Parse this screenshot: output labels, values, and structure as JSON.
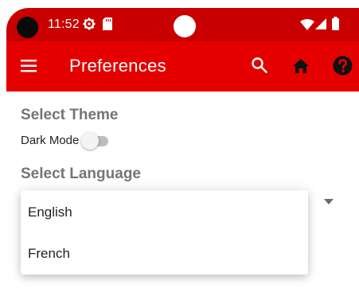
{
  "status_bar": {
    "time": "11:52",
    "icons": [
      "settings-icon",
      "sd-card-icon",
      "wifi-icon",
      "signal-icon",
      "battery-icon"
    ]
  },
  "app_bar": {
    "title": "Preferences",
    "icons": [
      "menu-icon",
      "search-icon",
      "home-icon",
      "help-icon"
    ]
  },
  "theme": {
    "title": "Select Theme",
    "dark_mode_label": "Dark Mode",
    "dark_mode_on": false
  },
  "language": {
    "title": "Select Language",
    "options": [
      "English",
      "French"
    ]
  },
  "colors": {
    "status_bar": "#c80000",
    "app_bar": "#e50000",
    "section_title": "#757575"
  }
}
